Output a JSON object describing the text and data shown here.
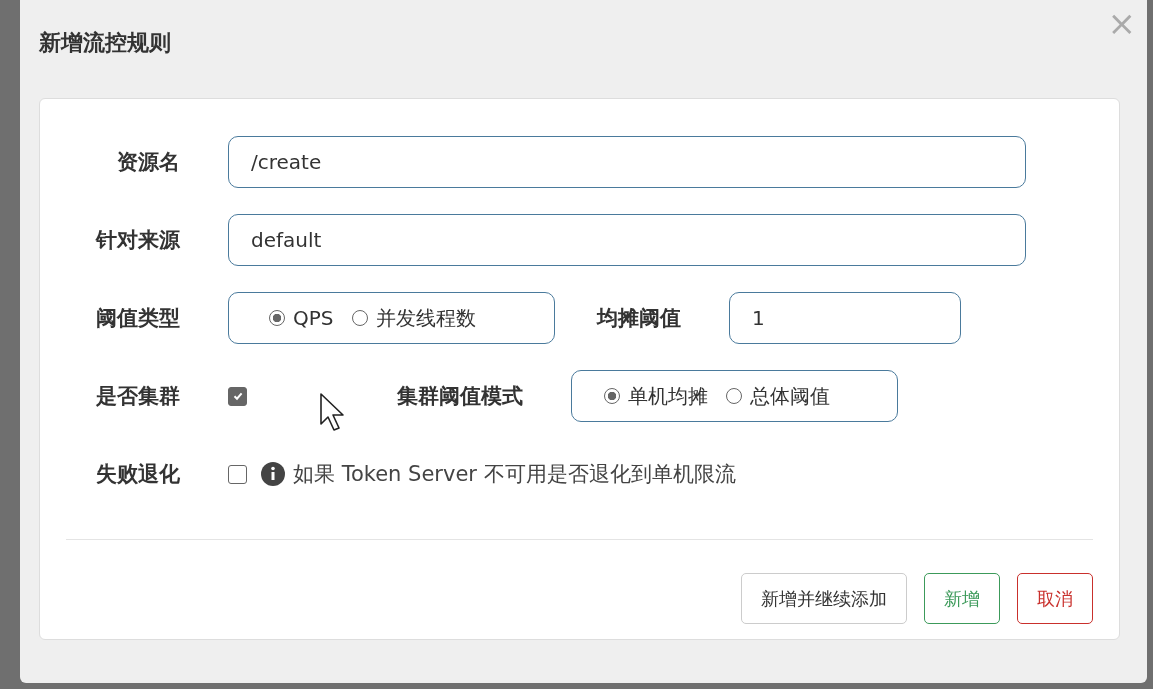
{
  "dialog": {
    "title": "新增流控规则",
    "close": "×",
    "fields": [
      {
        "kind": "text",
        "label": "资源名",
        "value": "/create"
      },
      {
        "kind": "text",
        "label": "针对来源",
        "value": "default"
      }
    ],
    "threshold_type": {
      "label": "阈值类型",
      "options": [
        {
          "label": "QPS",
          "selected": true
        },
        {
          "label": "并发线程数",
          "selected": false
        }
      ],
      "side_label": "均摊阈值",
      "side_value": "1"
    },
    "cluster": {
      "label": "是否集群",
      "checked": true,
      "mode_label": "集群阈值模式",
      "options": [
        {
          "label": "单机均摊",
          "selected": true
        },
        {
          "label": "总体阈值",
          "selected": false
        }
      ]
    },
    "fallback": {
      "label": "失败退化",
      "checked": false,
      "hint": "如果 Token Server 不可用是否退化到单机限流"
    },
    "buttons": [
      {
        "kind": "default",
        "label": "新增并继续添加"
      },
      {
        "kind": "success",
        "label": "新增"
      },
      {
        "kind": "danger",
        "label": "取消"
      }
    ]
  }
}
